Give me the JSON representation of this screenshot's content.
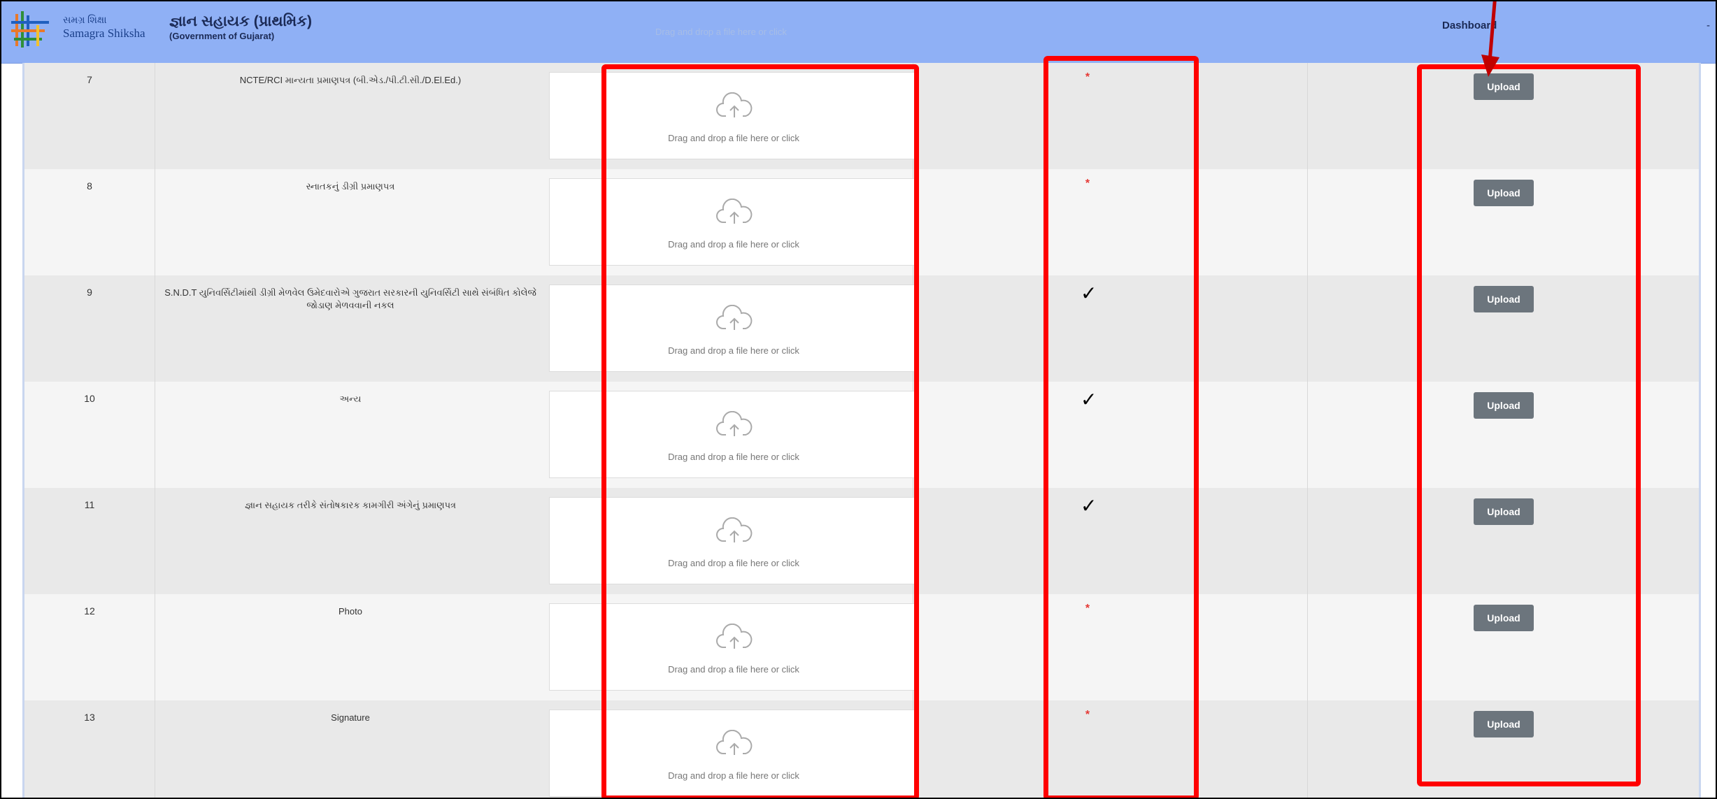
{
  "header": {
    "logo_line1": "સમગ્ર શિક્ષા",
    "logo_line2": "Samagra Shiksha",
    "title": "જ્ઞાન સહાયક (પ્રાથમિક)",
    "subtitle": "(Government of Gujarat)",
    "ghost_drop_text": "Drag and drop a file here or click",
    "nav_dashboard": "Dashboard",
    "nav_extra": "-"
  },
  "dropzone_text": "Drag and drop a file here or click",
  "upload_label": "Upload",
  "rows": [
    {
      "num": "7",
      "name": "NCTE/RCI માન્યતા પ્રમાણપત્ર (બી.એડ./પી.ટી.સી./D.El.Ed.)",
      "status": "required"
    },
    {
      "num": "8",
      "name": "સ્નાતકનું ડીગ્રી પ્રમાણપત્ર",
      "status": "required"
    },
    {
      "num": "9",
      "name": "S.N.D.T યુનિવર્સિટીમાંથી ડીગ્રી મેળવેલ ઉમેદવારોએ ગુજરાત સરકારની યુનિવર્સિટી સાથે સંબંધિત કોલેજે જોડાણ મેળવવાની નકલ",
      "status": "checked"
    },
    {
      "num": "10",
      "name": "અન્ય",
      "status": "checked"
    },
    {
      "num": "11",
      "name": "જ્ઞાન સહાયક તરીકે સંતોષકારક કામગીરી અંગેનું પ્રમાણપત્ર",
      "status": "checked"
    },
    {
      "num": "12",
      "name": "Photo",
      "status": "required"
    },
    {
      "num": "13",
      "name": "Signature",
      "status": "required"
    }
  ],
  "status_symbols": {
    "required": "*",
    "checked": "✓"
  },
  "colors": {
    "header_bg": "#8fb0f5",
    "upload_button": "#6c757d",
    "annotation": "#ff0000"
  }
}
